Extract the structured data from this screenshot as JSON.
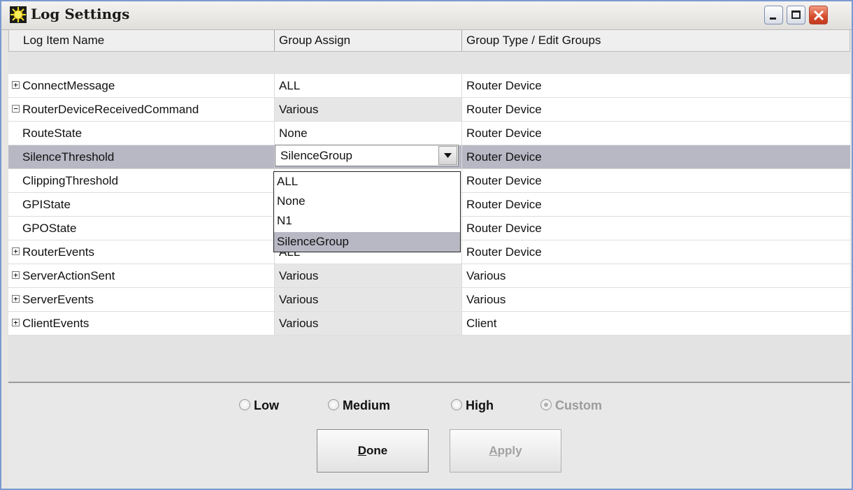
{
  "window": {
    "title": "Log Settings"
  },
  "columns": [
    "Log Item Name",
    "Group Assign",
    "Group Type / Edit Groups"
  ],
  "rows": [
    {
      "name": "ConnectMessage",
      "expander": "+",
      "group": "ALL",
      "type": "Router Device"
    },
    {
      "name": "RouterDeviceReceivedCommand",
      "expander": "−",
      "group": "Various",
      "type": "Router Device"
    },
    {
      "name": "RouteState",
      "expander": "",
      "group": "None",
      "type": "Router Device"
    },
    {
      "name": "SilenceThreshold",
      "expander": "",
      "group": "SilenceGroup",
      "type": "Router Device"
    },
    {
      "name": "ClippingThreshold",
      "expander": "",
      "group": "",
      "type": "Router Device"
    },
    {
      "name": "GPIState",
      "expander": "",
      "group": "",
      "type": "Router Device"
    },
    {
      "name": "GPOState",
      "expander": "",
      "group": "",
      "type": "Router Device"
    },
    {
      "name": "RouterEvents",
      "expander": "+",
      "group": "ALL",
      "type": "Router Device"
    },
    {
      "name": "ServerActionSent",
      "expander": "+",
      "group": "Various",
      "type": "Various"
    },
    {
      "name": "ServerEvents",
      "expander": "+",
      "group": "Various",
      "type": "Various"
    },
    {
      "name": "ClientEvents",
      "expander": "+",
      "group": "Various",
      "type": "Client"
    }
  ],
  "combo": {
    "value": "SilenceGroup",
    "options": [
      "ALL",
      "None",
      "N1",
      "SilenceGroup"
    ]
  },
  "levels": [
    {
      "first": "L",
      "rest": "ow"
    },
    {
      "first": "M",
      "rest": "edium"
    },
    {
      "first": "H",
      "rest": "igh"
    },
    {
      "first": "C",
      "rest": "ustom"
    }
  ],
  "buttons": {
    "done": {
      "first": "D",
      "rest": "one"
    },
    "apply": {
      "first": "A",
      "rest": "pply"
    }
  },
  "colors": {
    "selection": "#b7b8c4",
    "close": "#d54b2c"
  }
}
